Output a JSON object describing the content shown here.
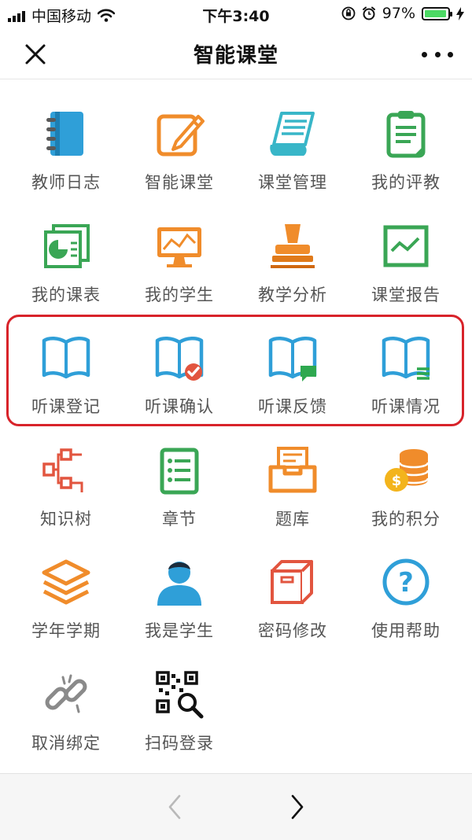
{
  "status": {
    "carrier": "中国移动",
    "time": "下午3:40",
    "battery": "97%",
    "battery_level": 0.97
  },
  "header": {
    "title": "智能课堂"
  },
  "grid": [
    {
      "label": "教师日志",
      "icon": "notebook-icon"
    },
    {
      "label": "智能课堂",
      "icon": "pencil-pad-icon"
    },
    {
      "label": "课堂管理",
      "icon": "scroll-icon"
    },
    {
      "label": "我的评教",
      "icon": "clipboard-icon"
    },
    {
      "label": "我的课表",
      "icon": "schedule-chart-icon"
    },
    {
      "label": "我的学生",
      "icon": "monitor-chart-icon"
    },
    {
      "label": "教学分析",
      "icon": "stamp-icon"
    },
    {
      "label": "课堂报告",
      "icon": "report-chart-icon"
    },
    {
      "label": "听课登记",
      "icon": "open-book-icon"
    },
    {
      "label": "听课确认",
      "icon": "book-check-icon"
    },
    {
      "label": "听课反馈",
      "icon": "book-chat-icon"
    },
    {
      "label": "听课情况",
      "icon": "book-list-icon"
    },
    {
      "label": "知识树",
      "icon": "tree-structure-icon"
    },
    {
      "label": "章节",
      "icon": "list-icon"
    },
    {
      "label": "题库",
      "icon": "inbox-icon"
    },
    {
      "label": "我的积分",
      "icon": "coins-icon"
    },
    {
      "label": "学年学期",
      "icon": "layers-icon"
    },
    {
      "label": "我是学生",
      "icon": "student-icon"
    },
    {
      "label": "密码修改",
      "icon": "box-icon"
    },
    {
      "label": "使用帮助",
      "icon": "help-icon"
    },
    {
      "label": "取消绑定",
      "icon": "broken-link-icon"
    },
    {
      "label": "扫码登录",
      "icon": "qr-scan-icon"
    }
  ],
  "colors": {
    "blue": "#2f9fd8",
    "orange": "#f08c2b",
    "green": "#3aa655",
    "red": "#e2553f",
    "highlight": "#d8232a"
  }
}
